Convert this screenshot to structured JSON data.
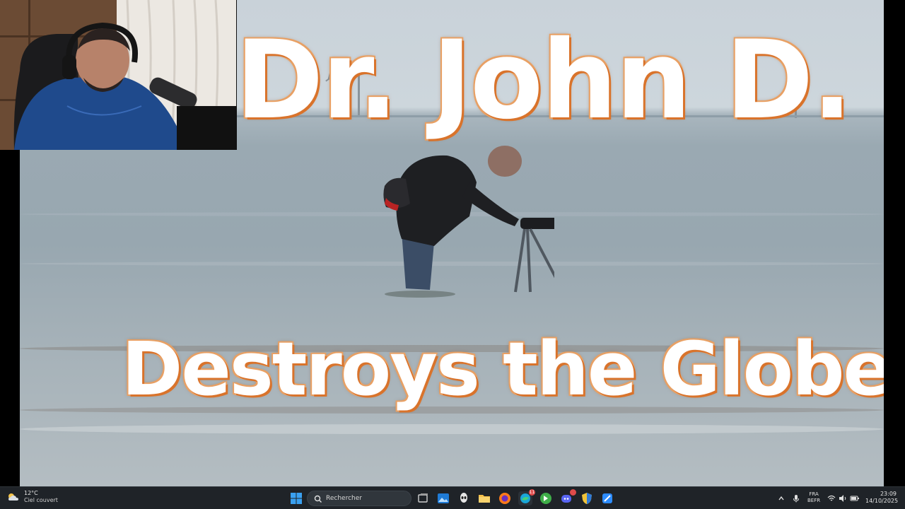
{
  "video": {
    "title_line1": "Dr. John D.",
    "title_line2": "Destroys the Globe"
  },
  "taskbar": {
    "weather": {
      "temperature": "12°C",
      "condition": "Ciel couvert"
    },
    "search_placeholder": "Rechercher",
    "language": {
      "lang": "FRA",
      "layout": "BEFR"
    },
    "clock": {
      "time": "23:09",
      "date": "14/10/2025"
    },
    "apps": [
      {
        "name": "windows-start-icon",
        "badge": ""
      },
      {
        "name": "task-view-icon",
        "badge": ""
      },
      {
        "name": "photos-icon",
        "badge": ""
      },
      {
        "name": "alien-app-icon",
        "badge": ""
      },
      {
        "name": "file-explorer-icon",
        "badge": ""
      },
      {
        "name": "firefox-icon",
        "badge": ""
      },
      {
        "name": "edge-icon",
        "badge": "11"
      },
      {
        "name": "green-app-icon",
        "badge": ""
      },
      {
        "name": "discord-icon",
        "badge": ""
      },
      {
        "name": "security-shield-icon",
        "badge": ""
      },
      {
        "name": "blue-app-icon",
        "badge": ""
      }
    ]
  },
  "colors": {
    "taskbar_bg": "#1f2328",
    "title_text": "#ffffff",
    "title_outline": "#d9732b",
    "sea": "#9aa9b2",
    "sky": "#c9d2d9"
  }
}
